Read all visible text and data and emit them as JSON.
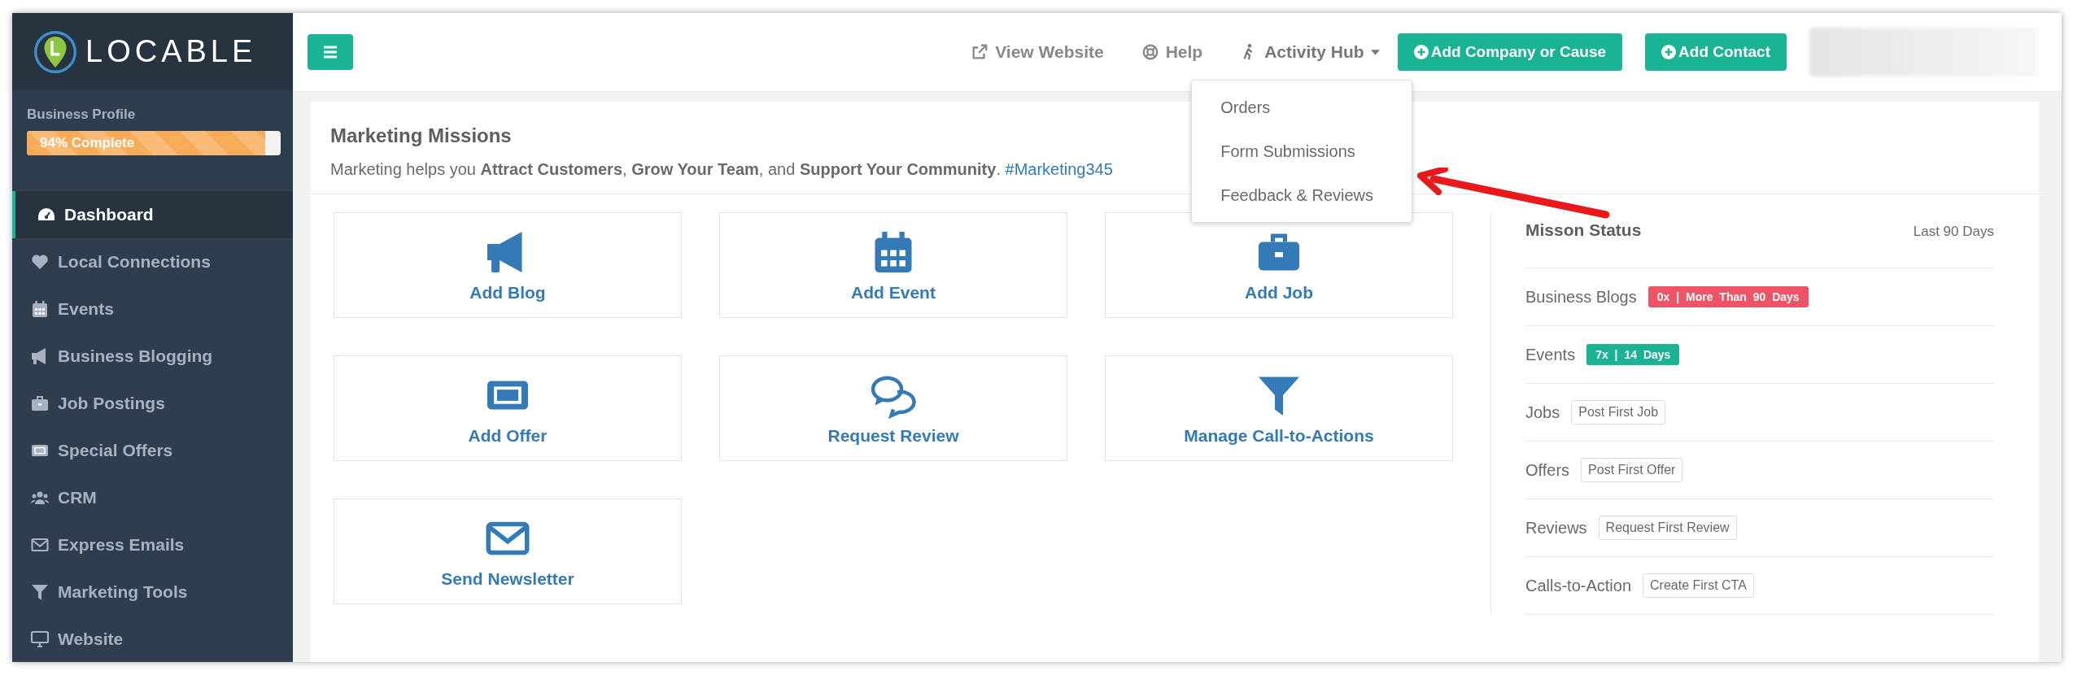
{
  "brand": {
    "name": "LOCABLE"
  },
  "profile": {
    "label": "Business Profile",
    "progress": {
      "level": 0.94,
      "text": "94% Complete"
    }
  },
  "sidebar": {
    "items": [
      {
        "label": "Dashboard",
        "selected": true
      },
      {
        "label": "Local Connections",
        "selected": false
      },
      {
        "label": "Events",
        "selected": false
      },
      {
        "label": "Business Blogging",
        "selected": false
      },
      {
        "label": "Job Postings",
        "selected": false
      },
      {
        "label": "Special Offers",
        "selected": false
      },
      {
        "label": "CRM",
        "selected": false
      },
      {
        "label": "Express Emails",
        "selected": false
      },
      {
        "label": "Marketing Tools",
        "selected": false
      },
      {
        "label": "Website",
        "selected": false
      }
    ]
  },
  "topbar": {
    "links": [
      {
        "label": "View Website"
      },
      {
        "label": "Help"
      }
    ],
    "activity_hub": {
      "label": "Activity Hub",
      "expanded": true,
      "items": [
        "Orders",
        "Form Submissions",
        "Feedback & Reviews"
      ]
    },
    "buttons": [
      "Add Company or Cause",
      "Add Contact"
    ]
  },
  "missions": {
    "title": "Marketing Missions",
    "intro": "Marketing helps you **Attract Customers**, **Grow Your Team**, and **Support Your Community**.",
    "hashtag": "#Marketing345",
    "tiles": [
      {
        "label": "Add Blog"
      },
      {
        "label": "Add Event"
      },
      {
        "label": "Add Job"
      },
      {
        "label": "Add Offer"
      },
      {
        "label": "Request Review"
      },
      {
        "label": "Manage Call-to-Actions"
      },
      {
        "label": "Send Newsletter"
      }
    ]
  },
  "status": {
    "title": "Misson Status",
    "period": "Last 90 Days",
    "rows": [
      {
        "label": "Business Blogs",
        "kind": "badge",
        "text": "0x | More Than 90 Days",
        "color": "#ef5366"
      },
      {
        "label": "Events",
        "kind": "badge",
        "text": "7x | 14 Days",
        "color": "#1bb394"
      },
      {
        "label": "Jobs",
        "kind": "action",
        "text": "Post First Job"
      },
      {
        "label": "Offers",
        "kind": "action",
        "text": "Post First Offer"
      },
      {
        "label": "Reviews",
        "kind": "action",
        "text": "Request First Review"
      },
      {
        "label": "Calls-to-Action",
        "kind": "action",
        "text": "Create First CTA"
      }
    ]
  }
}
